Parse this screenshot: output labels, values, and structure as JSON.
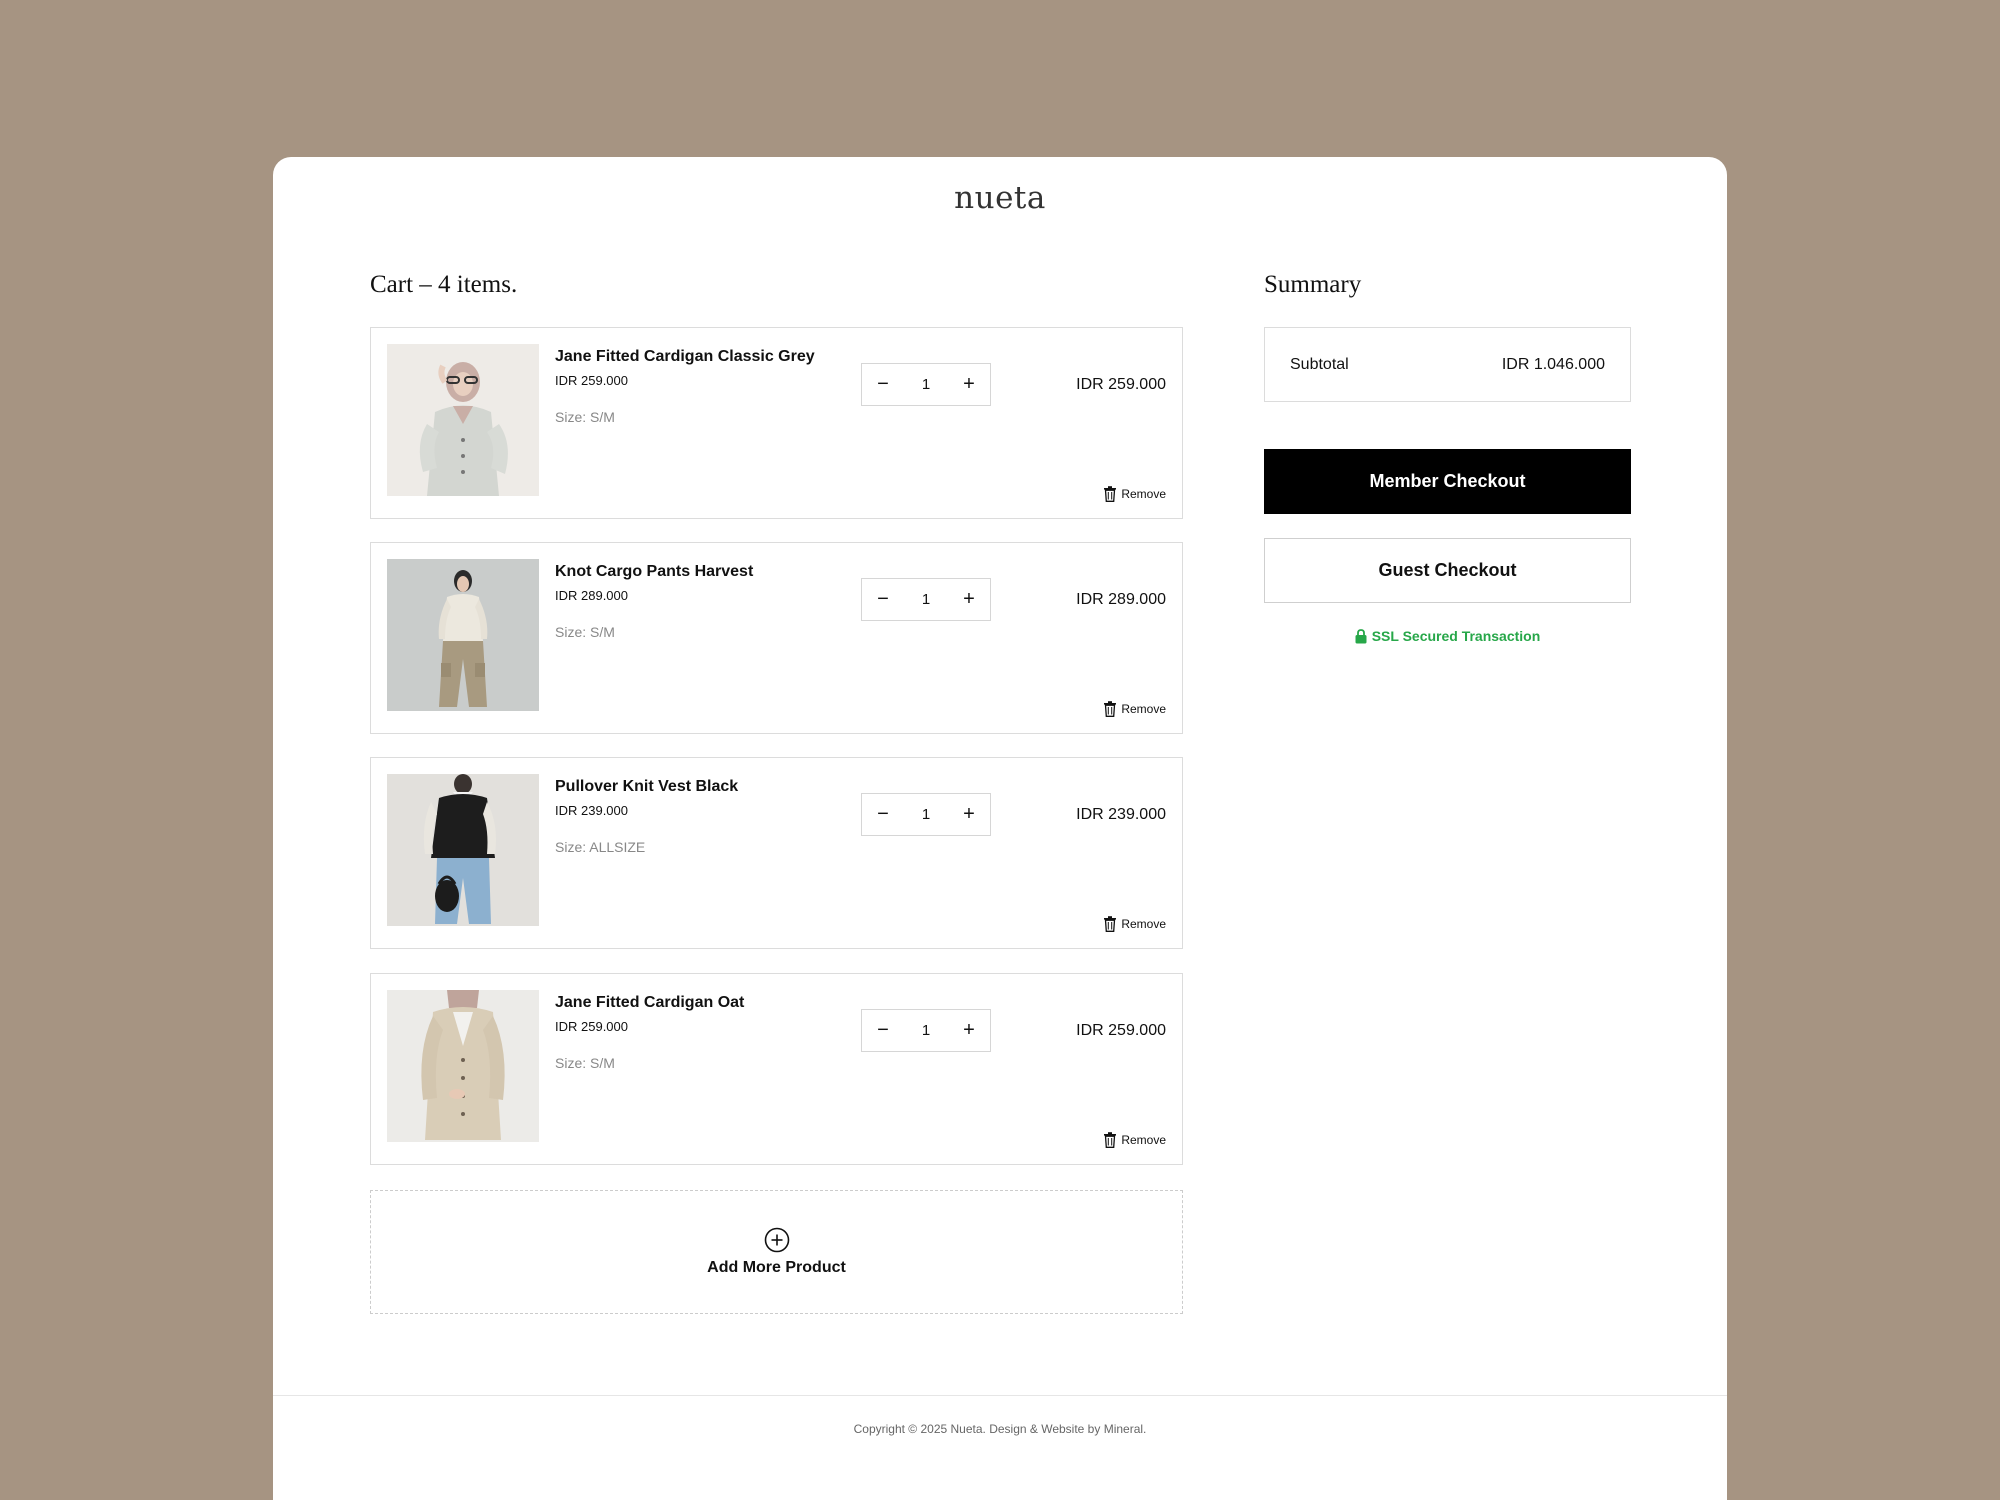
{
  "brand": {
    "logo": "nueta"
  },
  "cart": {
    "title": "Cart – 4 items.",
    "items": [
      {
        "name": "Jane Fitted Cardigan Classic Grey",
        "price": "IDR 259.000",
        "size": "Size: S/M",
        "quantity": "1",
        "total": "IDR 259.000",
        "remove_label": "Remove"
      },
      {
        "name": "Knot Cargo Pants Harvest",
        "price": "IDR 289.000",
        "size": "Size: S/M",
        "quantity": "1",
        "total": "IDR 289.000",
        "remove_label": "Remove"
      },
      {
        "name": "Pullover Knit Vest Black",
        "price": "IDR 239.000",
        "size": "Size: ALLSIZE",
        "quantity": "1",
        "total": "IDR 239.000",
        "remove_label": "Remove"
      },
      {
        "name": "Jane Fitted Cardigan Oat",
        "price": "IDR 259.000",
        "size": "Size: S/M",
        "quantity": "1",
        "total": "IDR 259.000",
        "remove_label": "Remove"
      }
    ],
    "decrement_symbol": "−",
    "increment_symbol": "+",
    "add_more_label": "Add More Product"
  },
  "summary": {
    "title": "Summary",
    "subtotal_label": "Subtotal",
    "subtotal_value": "IDR 1.046.000",
    "member_checkout_label": "Member Checkout",
    "guest_checkout_label": "Guest Checkout",
    "ssl_label": "SSL Secured Transaction"
  },
  "footer": {
    "copyright": "Copyright © 2025 Nueta. Design & Website by Mineral."
  },
  "icons": {
    "remove": "trash-icon",
    "add": "plus-circle-icon",
    "ssl": "lock-icon"
  },
  "colors": {
    "background": "#a69482",
    "primary_button": "#000000",
    "ssl_green": "#27a749"
  }
}
